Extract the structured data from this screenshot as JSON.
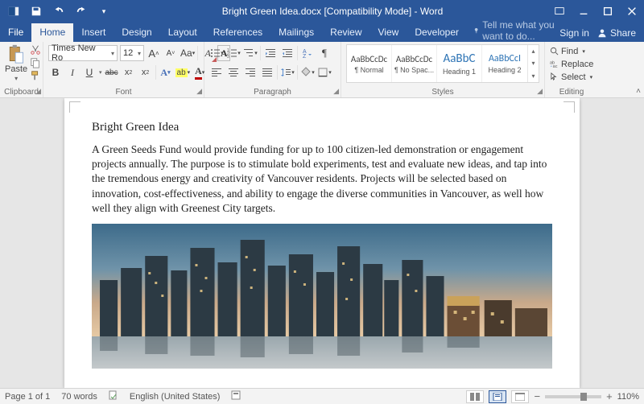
{
  "title": "Bright Green Idea.docx [Compatibility Mode] - Word",
  "qat": {
    "save": "save-icon",
    "undo": "undo-icon",
    "redo": "redo-icon"
  },
  "tabs": [
    "File",
    "Home",
    "Insert",
    "Design",
    "Layout",
    "References",
    "Mailings",
    "Review",
    "View",
    "Developer"
  ],
  "active_tab": "Home",
  "tellme_placeholder": "Tell me what you want to do...",
  "account": {
    "signin": "Sign in",
    "share": "Share"
  },
  "ribbon": {
    "clipboard": {
      "label": "Clipboard",
      "paste": "Paste"
    },
    "font": {
      "label": "Font",
      "name": "Times New Ro",
      "size": "12",
      "grow": "A",
      "shrink": "A",
      "case": "Aa",
      "clear": "A",
      "bold": "B",
      "italic": "I",
      "underline": "U",
      "strike": "abc",
      "sub": "x₂",
      "sup": "x²",
      "effects": "A",
      "highlight": "ab",
      "fontcolor": "A"
    },
    "paragraph": {
      "label": "Paragraph"
    },
    "styles": {
      "label": "Styles",
      "items": [
        {
          "preview": "AaBbCcDc",
          "name": "¶ Normal",
          "color": "#333",
          "size": "11px"
        },
        {
          "preview": "AaBbCcDc",
          "name": "¶ No Spac...",
          "color": "#333",
          "size": "11px"
        },
        {
          "preview": "AaBbC",
          "name": "Heading 1",
          "color": "#2e74b5",
          "size": "15px"
        },
        {
          "preview": "AaBbCcI",
          "name": "Heading 2",
          "color": "#2e74b5",
          "size": "12px"
        }
      ]
    },
    "editing": {
      "label": "Editing",
      "find": "Find",
      "replace": "Replace",
      "select": "Select"
    }
  },
  "document": {
    "title": "Bright Green Idea",
    "body": "A Green Seeds Fund would provide funding for up to 100 citizen-led demonstration or engagement projects annually. The purpose is to stimulate bold experiments, test and evaluate new ideas, and tap into the tremendous energy and creativity of Vancouver residents. Projects will be selected based on innovation, cost-effectiveness, and ability to engage the diverse communities in Vancouver, as well how well they align with Greenest City targets."
  },
  "status": {
    "page": "Page 1 of 1",
    "words": "70 words",
    "lang": "English (United States)",
    "zoom": "110%"
  }
}
